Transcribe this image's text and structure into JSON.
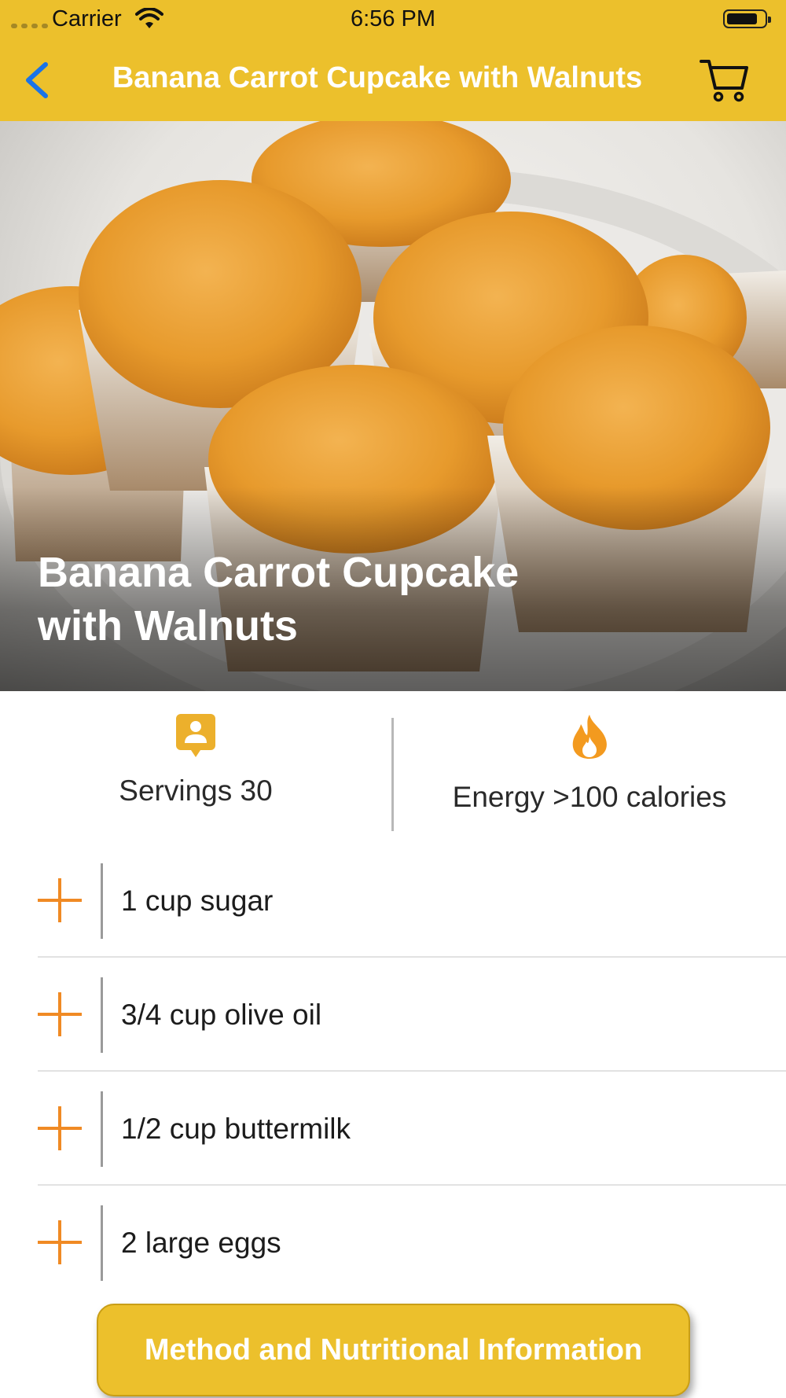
{
  "status_bar": {
    "carrier": "Carrier",
    "time": "6:56 PM"
  },
  "nav": {
    "title": "Banana Carrot Cupcake with Walnuts",
    "back_icon": "chevron-left-icon",
    "cart_icon": "cart-icon"
  },
  "hero": {
    "title": "Banana Carrot Cupcake with Walnuts",
    "image": "cupcakes-photo"
  },
  "info": {
    "servings": "Servings 30",
    "servings_icon": "person-badge-icon",
    "energy": "Energy >100 calories",
    "energy_icon": "flame-icon"
  },
  "ingredients": [
    {
      "text": "1 cup sugar"
    },
    {
      "text": "3/4 cup olive oil"
    },
    {
      "text": "1/2 cup buttermilk"
    },
    {
      "text": "2 large eggs"
    }
  ],
  "method_button": {
    "label": "Method and Nutritional Information"
  },
  "colors": {
    "header": "#ecc02c",
    "accent_orange": "#f08a24",
    "back_blue": "#1a73e8",
    "text": "#1c1c1c"
  }
}
